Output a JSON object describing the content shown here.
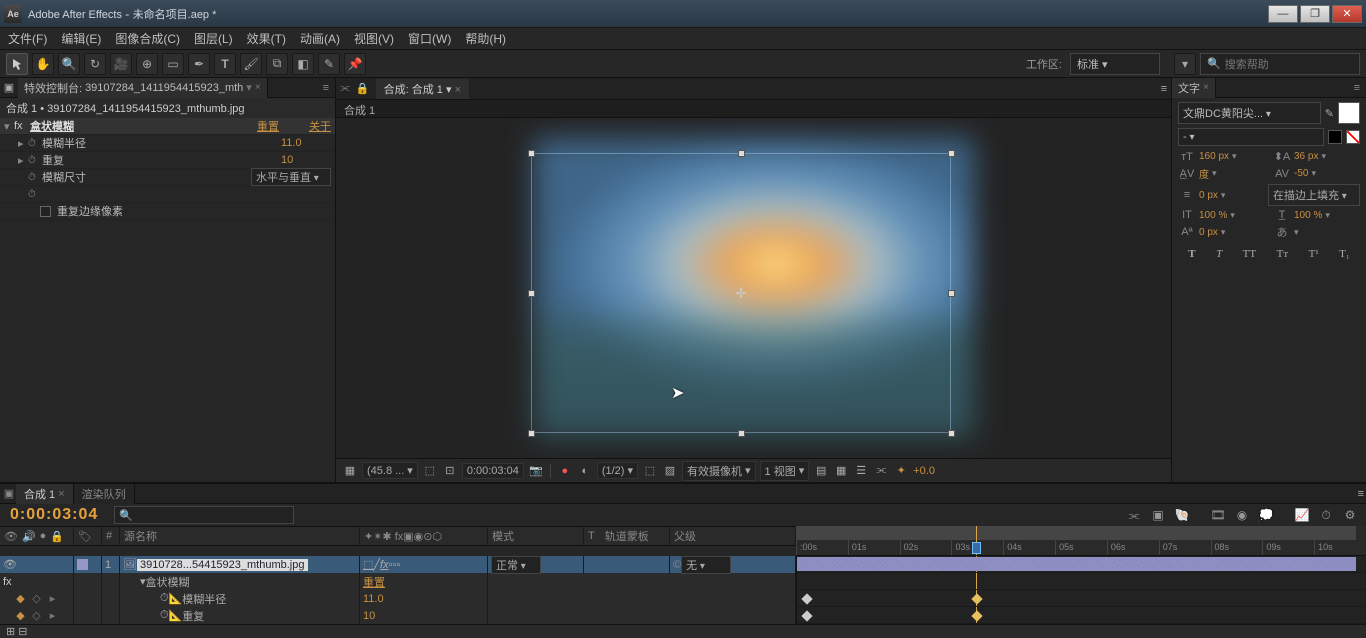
{
  "title_bar": {
    "app": "Adobe After Effects",
    "doc": "未命名项目.aep *",
    "logo": "Ae"
  },
  "menu": [
    "文件(F)",
    "编辑(E)",
    "图像合成(C)",
    "图层(L)",
    "效果(T)",
    "动画(A)",
    "视图(V)",
    "窗口(W)",
    "帮助(H)"
  ],
  "toolbar": {
    "workspace_label": "工作区:",
    "workspace_value": "标准",
    "search_placeholder": "搜索帮助"
  },
  "effects_panel": {
    "title_prefix": "特效控制台:",
    "layer_name": "39107284_1411954415923_mth",
    "breadcrumb": "合成 1 • 39107284_1411954415923_mthumb.jpg",
    "effect_name": "盒状模糊",
    "reset_label": "重置",
    "about_label": "关于",
    "props": {
      "blur_radius": {
        "label": "模糊半径",
        "value": "11.0"
      },
      "iterations": {
        "label": "重复",
        "value": "10"
      },
      "dimensions": {
        "label": "模糊尺寸",
        "value": "水平与垂直"
      },
      "spare": {
        "label": ""
      },
      "edge": {
        "label": "重复边缘像素"
      }
    }
  },
  "comp_panel": {
    "tab_prefix": "合成:",
    "tab_name": "合成 1",
    "sub_tab": "合成 1",
    "controls": {
      "mag": "(45.8 ...",
      "time": "0:00:03:04",
      "res": "(1/2)",
      "camera": "有效摄像机",
      "views": "1 视图",
      "exposure": "+0.0"
    }
  },
  "char_panel": {
    "title": "文字",
    "font": "文鼎DC黄阳尖...",
    "style": "-",
    "size": "160 px",
    "leading": "36 px",
    "kerning": "度",
    "tracking": "-50",
    "tsume": "0 px",
    "stroke_pos": "在描边上填充",
    "hscale": "100 %",
    "vscale": "100 %",
    "baseline": "0 px"
  },
  "timeline": {
    "tab1": "合成 1",
    "tab2": "渲染队列",
    "timecode": "0:00:03:04",
    "columns": {
      "source": "源名称",
      "mode": "模式",
      "trkmat": "轨道蒙板",
      "parent": "父级"
    },
    "layer": {
      "index": "1",
      "name": "3910728...54415923_mthumb.jpg",
      "mode": "正常",
      "parent_none": "无"
    },
    "effect": {
      "name": "盒状模糊",
      "reset": "重置"
    },
    "prop1": {
      "name": "模糊半径",
      "value": "11.0"
    },
    "prop2": {
      "name": "重复",
      "value": "10"
    },
    "ruler": [
      ":00s",
      "01s",
      "02s",
      "03s",
      "04s",
      "05s",
      "06s",
      "07s",
      "08s",
      "09s",
      "10s"
    ]
  }
}
